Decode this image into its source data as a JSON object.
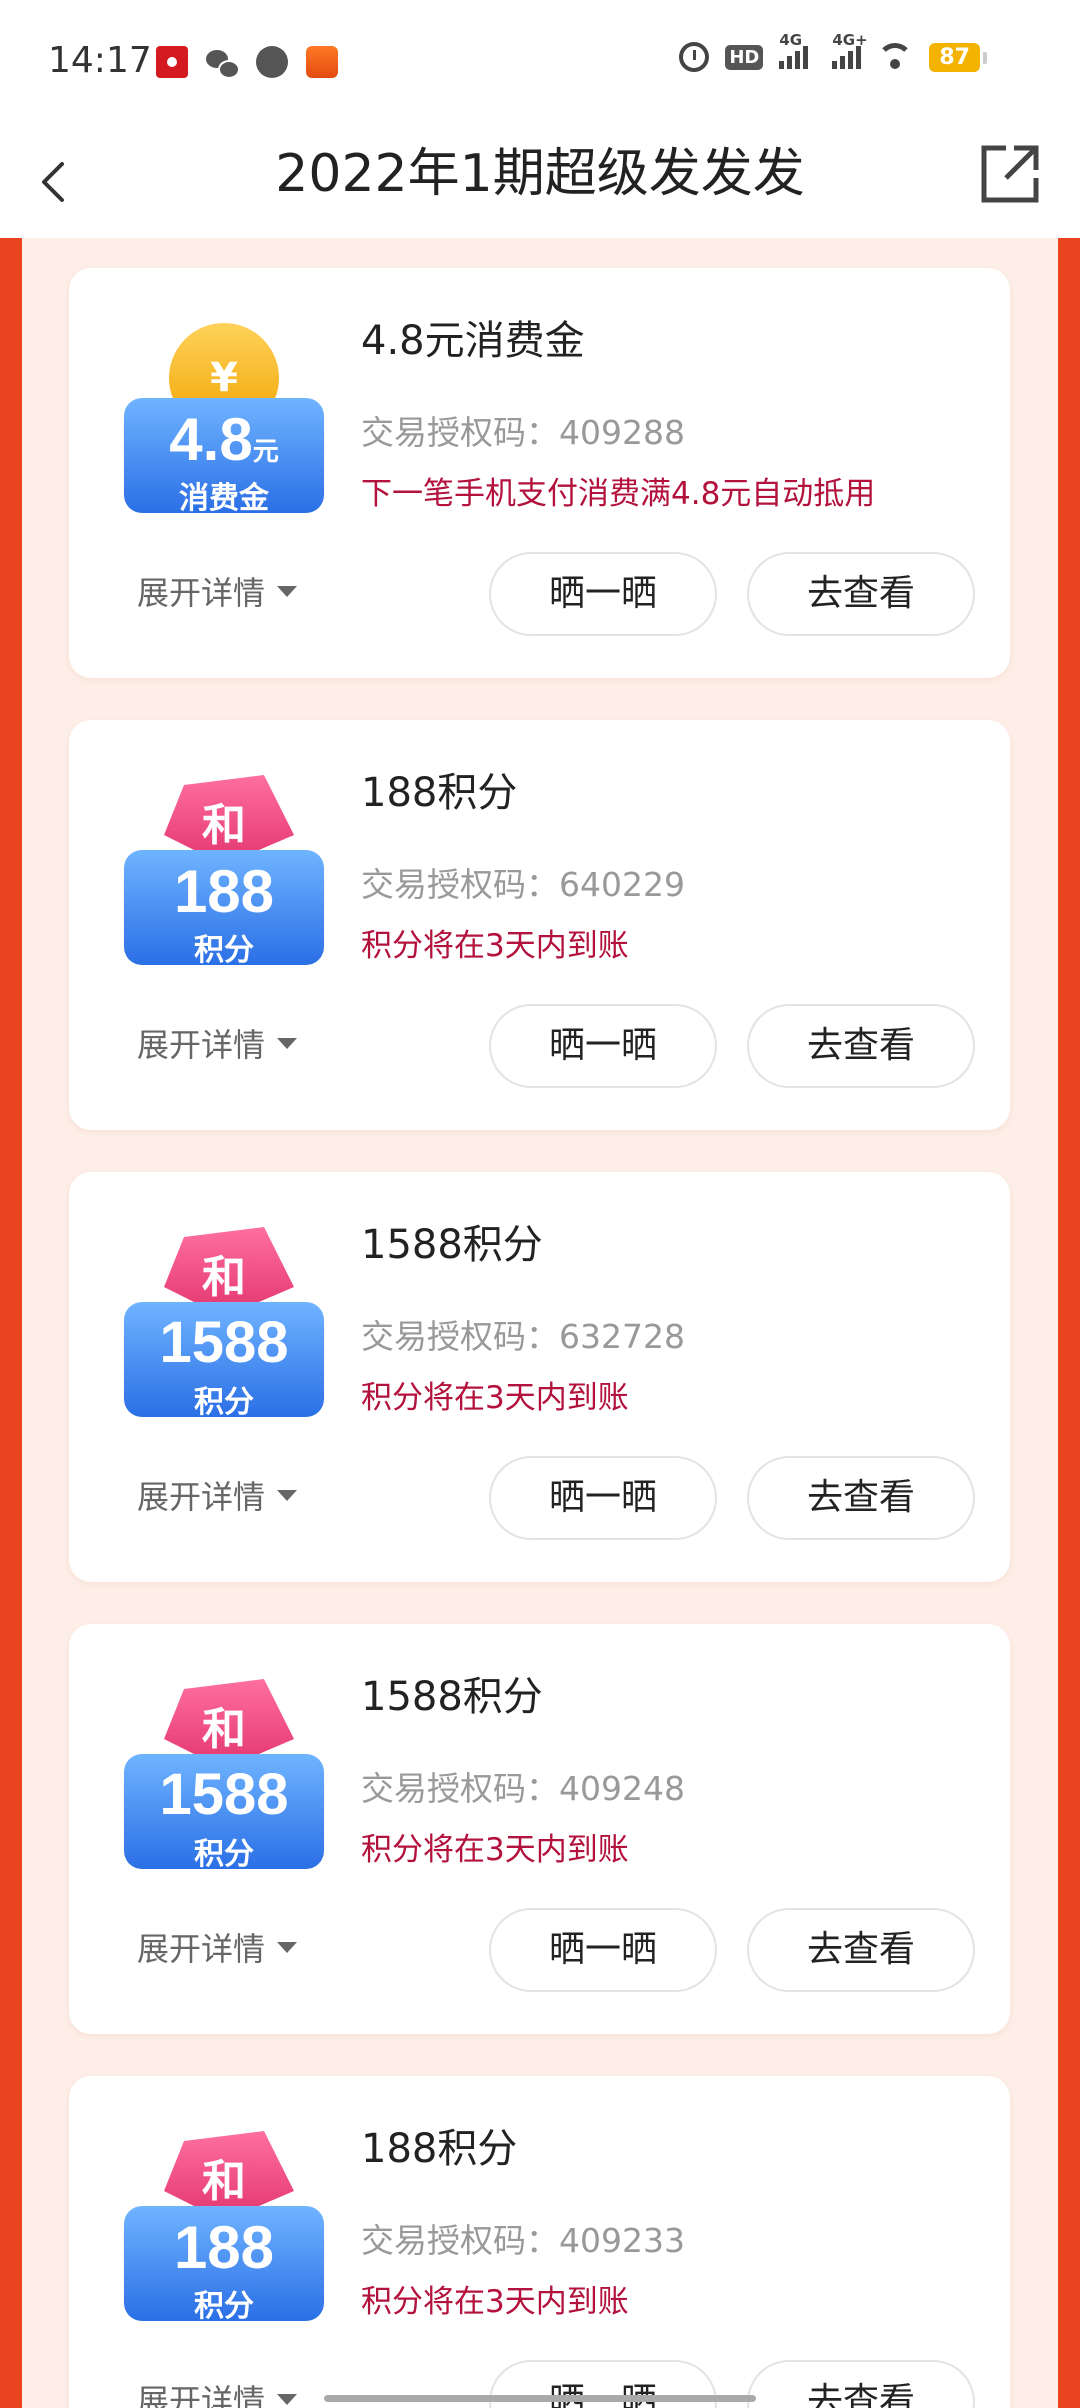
{
  "status_bar": {
    "time": "14:17",
    "hd": "HD",
    "net1": "4G",
    "net2": "4G+",
    "battery": "87"
  },
  "header": {
    "title": "2022年1期超级发发发"
  },
  "cards": [
    {
      "badge_type": "consumption-gold",
      "badge_value": "4.8",
      "badge_unit": "元",
      "badge_sub": "消费金",
      "title": "4.8元消费金",
      "auth_code": "交易授权码：409288",
      "note": "下一笔手机支付消费满4.8元自动抵用",
      "expand": "展开详情",
      "share_btn": "晒一晒",
      "view_btn": "去查看"
    },
    {
      "badge_type": "points",
      "badge_top": "和",
      "badge_value": "188",
      "badge_sub": "积分",
      "title": "188积分",
      "auth_code": "交易授权码：640229",
      "note": "积分将在3天内到账",
      "expand": "展开详情",
      "share_btn": "晒一晒",
      "view_btn": "去查看"
    },
    {
      "badge_type": "points",
      "badge_top": "和",
      "badge_value": "1588",
      "badge_sub": "积分",
      "title": "1588积分",
      "auth_code": "交易授权码：632728",
      "note": "积分将在3天内到账",
      "expand": "展开详情",
      "share_btn": "晒一晒",
      "view_btn": "去查看"
    },
    {
      "badge_type": "points",
      "badge_top": "和",
      "badge_value": "1588",
      "badge_sub": "积分",
      "title": "1588积分",
      "auth_code": "交易授权码：409248",
      "note": "积分将在3天内到账",
      "expand": "展开详情",
      "share_btn": "晒一晒",
      "view_btn": "去查看"
    },
    {
      "badge_type": "points",
      "badge_top": "和",
      "badge_value": "188",
      "badge_sub": "积分",
      "title": "188积分",
      "auth_code": "交易授权码：409233",
      "note": "积分将在3天内到账",
      "expand": "展开详情",
      "share_btn": "晒一晒",
      "view_btn": "去查看"
    }
  ],
  "colors": {
    "accent_red": "#e9431f",
    "note_red": "#b3123c",
    "content_bg": "#fdeee7"
  }
}
